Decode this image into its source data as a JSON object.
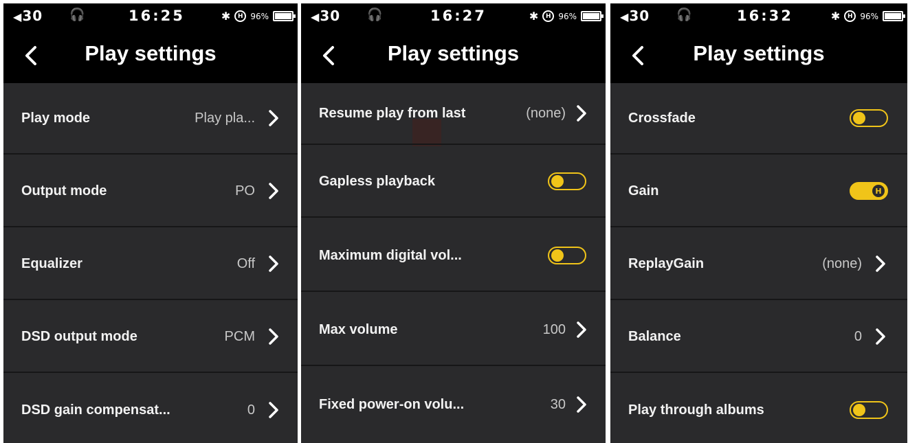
{
  "screens": [
    {
      "status": {
        "volume": "30",
        "time": "16:25",
        "battery": "96%"
      },
      "header": {
        "title": "Play settings"
      },
      "rows": [
        {
          "label": "Play mode",
          "value": "Play pla..."
        },
        {
          "label": "Output mode",
          "value": "PO"
        },
        {
          "label": "Equalizer",
          "value": "Off"
        },
        {
          "label": "DSD output mode",
          "value": "PCM"
        },
        {
          "label": "DSD gain compensat...",
          "value": "0"
        }
      ]
    },
    {
      "status": {
        "volume": "30",
        "time": "16:27",
        "battery": "96%"
      },
      "header": {
        "title": "Play settings"
      },
      "rows": [
        {
          "label": "Resume play from last",
          "value": "(none)"
        },
        {
          "label": "Gapless playback",
          "toggle": "off"
        },
        {
          "label": "Maximum digital vol...",
          "toggle": "off"
        },
        {
          "label": "Max volume",
          "value": "100"
        },
        {
          "label": "Fixed power-on volu...",
          "value": "30"
        }
      ]
    },
    {
      "status": {
        "volume": "30",
        "time": "16:32",
        "battery": "96%"
      },
      "header": {
        "title": "Play settings"
      },
      "rows": [
        {
          "label": "Crossfade",
          "toggle": "off"
        },
        {
          "label": "Gain",
          "toggle": "on",
          "toggle_knob_label": "H"
        },
        {
          "label": "ReplayGain",
          "value": "(none)"
        },
        {
          "label": "Balance",
          "value": "0"
        },
        {
          "label": "Play through albums",
          "toggle": "off"
        }
      ]
    }
  ],
  "status_icons": {
    "speaker": "speaker-icon",
    "headphones": "headphones-icon",
    "bluetooth": "bluetooth-icon",
    "hires": "H",
    "battery_level": 0.96
  },
  "colors": {
    "accent": "#f0c419",
    "background": "#2a2a2c",
    "header": "#000000",
    "divider": "#161617"
  }
}
